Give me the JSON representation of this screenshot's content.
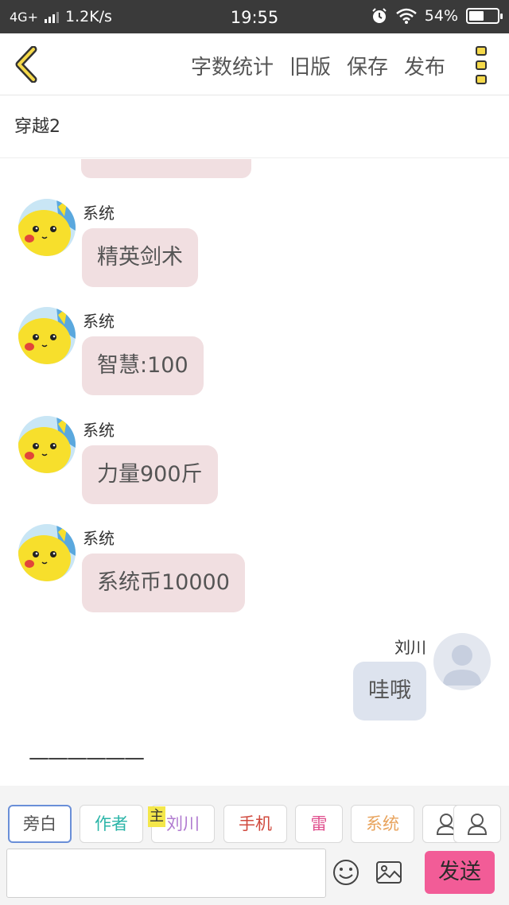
{
  "status_bar": {
    "network": "4G+",
    "speed": "1.2K/s",
    "time": "19:55",
    "battery": "54%",
    "battery_level": 0.54
  },
  "toolbar": {
    "word_count_label": "字数统计",
    "old_version_label": "旧版",
    "save_label": "保存",
    "publish_label": "发布"
  },
  "story": {
    "title": "穿越2"
  },
  "colors": {
    "left_bubble": "#f1dfe1",
    "right_bubble": "#dde3ee",
    "send_button": "#f25c97",
    "main_tag": "#f4e74a",
    "active_role_border": "#6a8fd8"
  },
  "messages": [
    {
      "sender": "系统",
      "text": "精英剑术",
      "side": "left",
      "avatar": "pikachu-avatar"
    },
    {
      "sender": "系统",
      "text": "智慧:100",
      "side": "left",
      "avatar": "pikachu-avatar"
    },
    {
      "sender": "系统",
      "text": "力量900斤",
      "side": "left",
      "avatar": "pikachu-avatar"
    },
    {
      "sender": "系统",
      "text": "系统币10000",
      "side": "left",
      "avatar": "pikachu-avatar"
    },
    {
      "sender": "刘川",
      "text": "哇哦",
      "side": "right",
      "avatar": "default-user-avatar"
    }
  ],
  "draft_text": "——————",
  "roles": [
    {
      "label": "旁白",
      "color": "#555555",
      "active": true
    },
    {
      "label": "作者",
      "color": "#2bb5a8",
      "active": false
    },
    {
      "label": "刘川",
      "color": "#b07ad0",
      "active": false
    },
    {
      "label": "手机",
      "color": "#d04a3e",
      "active": false
    },
    {
      "label": "雷",
      "color": "#e0508e",
      "active": false
    },
    {
      "label": "系统",
      "color": "#e8a35c",
      "active": false
    }
  ],
  "main_tag": "主",
  "input": {
    "value": "",
    "placeholder": ""
  },
  "send_label": "发送"
}
